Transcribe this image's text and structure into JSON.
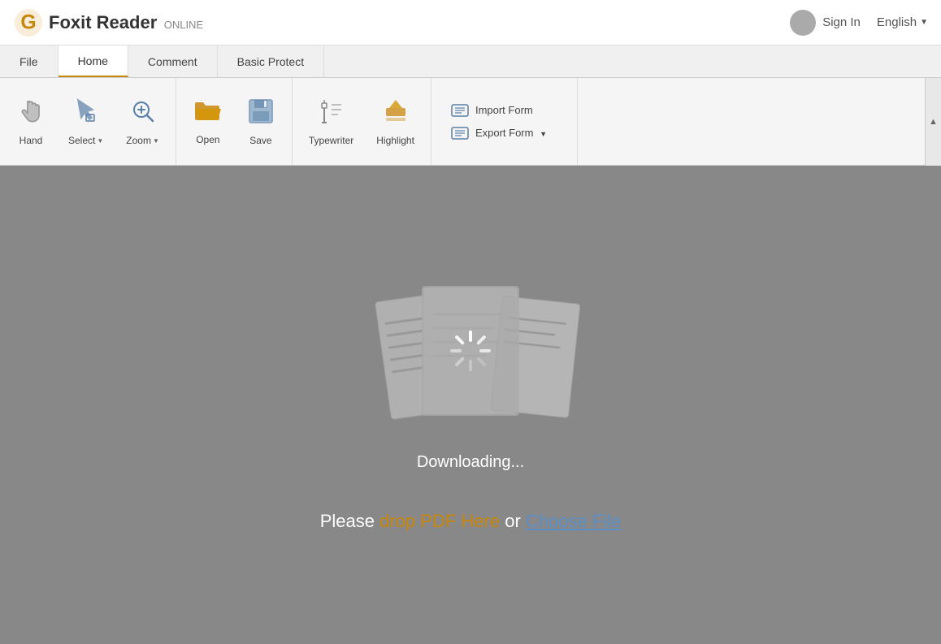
{
  "header": {
    "logo_text": "Foxit Reader",
    "logo_online": "ONLINE",
    "sign_in_label": "Sign In",
    "language": "English"
  },
  "nav": {
    "tabs": [
      {
        "id": "file",
        "label": "File",
        "active": false
      },
      {
        "id": "home",
        "label": "Home",
        "active": true
      },
      {
        "id": "comment",
        "label": "Comment",
        "active": false
      },
      {
        "id": "basic-protect",
        "label": "Basic Protect",
        "active": false
      }
    ]
  },
  "toolbar": {
    "groups": [
      {
        "id": "tools",
        "items": [
          {
            "id": "hand",
            "label": "Hand",
            "icon": "hand"
          },
          {
            "id": "select",
            "label": "Select",
            "icon": "select",
            "has_chevron": true
          },
          {
            "id": "zoom",
            "label": "Zoom",
            "icon": "zoom",
            "has_chevron": true
          }
        ]
      },
      {
        "id": "file-ops",
        "items": [
          {
            "id": "open",
            "label": "Open",
            "icon": "open"
          },
          {
            "id": "save",
            "label": "Save",
            "icon": "save"
          }
        ]
      },
      {
        "id": "annotations",
        "items": [
          {
            "id": "typewriter",
            "label": "Typewriter",
            "icon": "typewriter"
          },
          {
            "id": "highlight",
            "label": "Highlight",
            "icon": "highlight"
          }
        ]
      }
    ],
    "form_group": {
      "import_label": "Import Form",
      "export_label": "Export Form"
    },
    "collapse_icon": "▲"
  },
  "main": {
    "downloading_text": "Downloading...",
    "drop_text": "Please",
    "drop_link_text": "drop PDF Here",
    "or_text": "or",
    "choose_link_text": "Choose File"
  }
}
